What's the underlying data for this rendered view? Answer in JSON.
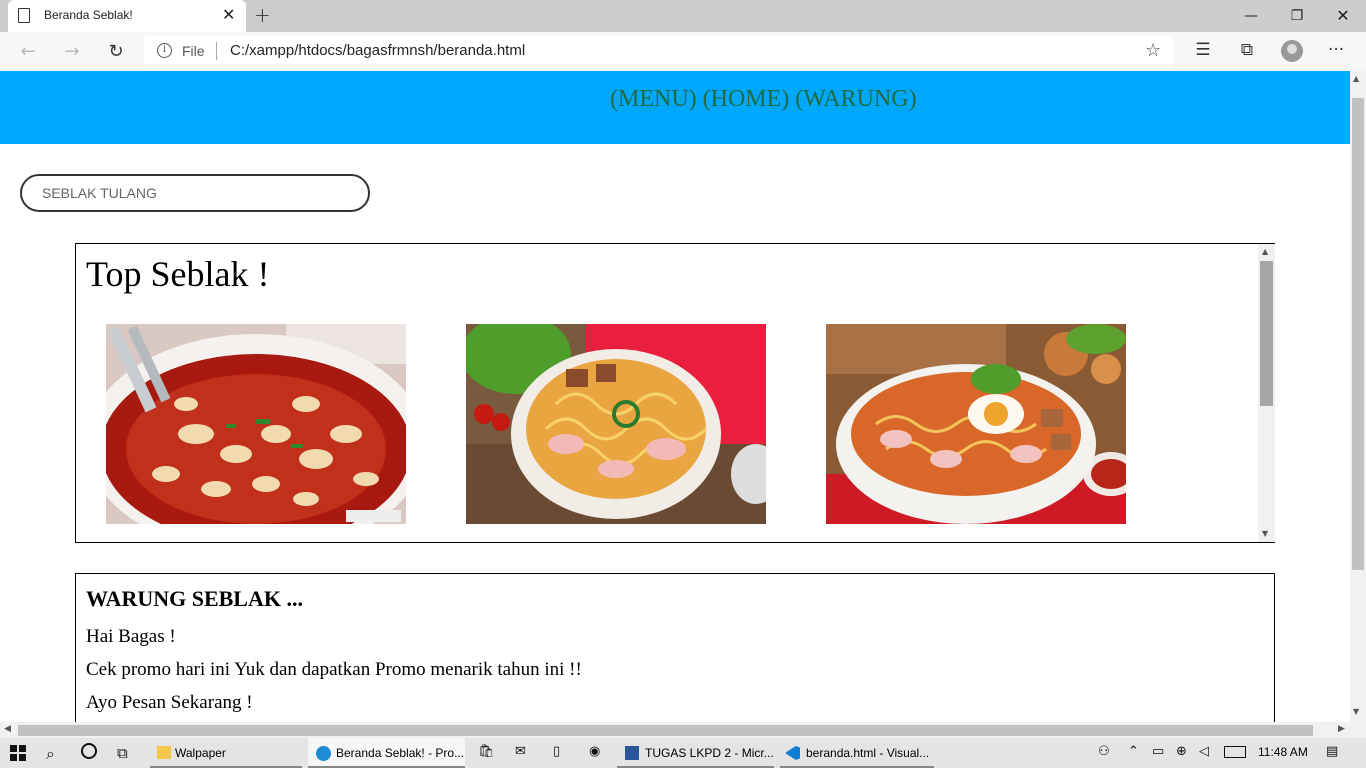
{
  "browser": {
    "tab_title": "Beranda Seblak!",
    "url_scheme_label": "File",
    "url": "C:/xampp/htdocs/bagasfrmnsh/beranda.html",
    "icons": [
      "page-icon",
      "close-icon",
      "plus-icon",
      "minimize-icon",
      "restore-icon",
      "close-window-icon",
      "back-icon",
      "forward-icon",
      "refresh-icon",
      "info-icon",
      "favorite-star-icon",
      "favorites-icon",
      "collections-icon",
      "profile-icon",
      "more-icon"
    ]
  },
  "page": {
    "banner_color": "#00a8fb",
    "nav_text": "(MENU) (HOME) (WARUNG)",
    "search_placeholder": "SEBLAK TULANG",
    "top_section": {
      "title": "Top Seblak !",
      "images": [
        "seblak-tulang-photo",
        "seblak-bowl-photo",
        "seblak-egg-photo"
      ]
    },
    "warung_section": {
      "title": "WARUNG SEBLAK ...",
      "lines": [
        "Hai Bagas !",
        "Cek promo hari ini Yuk dan dapatkan Promo menarik tahun ini !!",
        "Ayo Pesan Sekarang !"
      ]
    }
  },
  "taskbar": {
    "items": [
      {
        "label": "Walpaper",
        "icon": "folder-icon"
      },
      {
        "label": "Beranda Seblak! - Pro...",
        "icon": "edge-icon"
      },
      {
        "label": "TUGAS LKPD 2 - Micr...",
        "icon": "word-icon"
      },
      {
        "label": "beranda.html - Visual...",
        "icon": "vscode-icon"
      }
    ],
    "clock": "11:48 AM"
  }
}
